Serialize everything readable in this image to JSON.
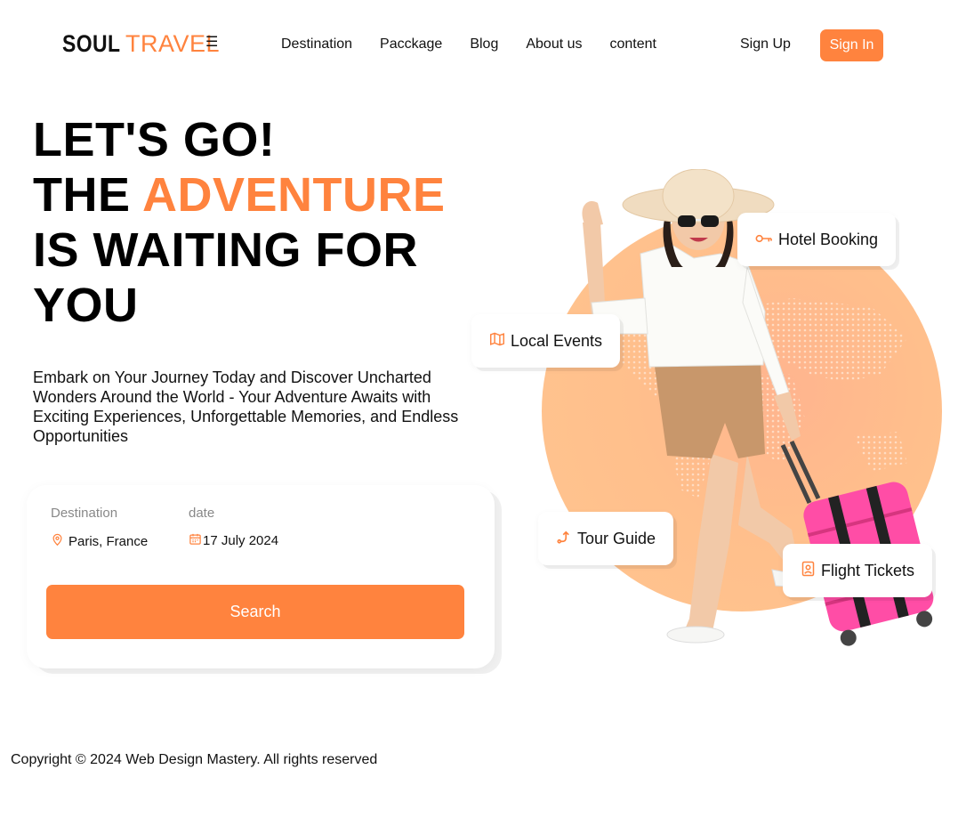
{
  "header": {
    "logo_part1": "SOUL",
    "logo_part2": "TRAVEL",
    "menu_icon": "☰",
    "nav": [
      "Destination",
      "Pacckage",
      "Blog",
      "About us",
      "content"
    ],
    "sign_up": "Sign Up",
    "sign_in": "Sign In"
  },
  "hero": {
    "line1": "LET'S GO!",
    "line2_prefix": "THE ",
    "line2_accent": "ADVENTURE",
    "line3": "IS WAITING FOR",
    "line4": "YOU",
    "description": "Embark on Your Journey Today and Discover Uncharted Wonders Around the World - Your Adventure Awaits with Exciting Experiences, Unforgettable Memories, and Endless Opportunities"
  },
  "search": {
    "destination_label": "Destination",
    "destination_value": "Paris, France",
    "date_label": "date",
    "date_value": "17 July 2024",
    "button": "Search"
  },
  "features": {
    "hotel": "Hotel Booking",
    "events": "Local Events",
    "guide": "Tour Guide",
    "flights": "Flight Tickets"
  },
  "footer": {
    "copyright": "Copyright © 2024 Web Design Mastery. All rights reserved"
  },
  "colors": {
    "accent": "#ff833e",
    "luggage": "#ff4da6",
    "circle": "#ffbf8c"
  }
}
